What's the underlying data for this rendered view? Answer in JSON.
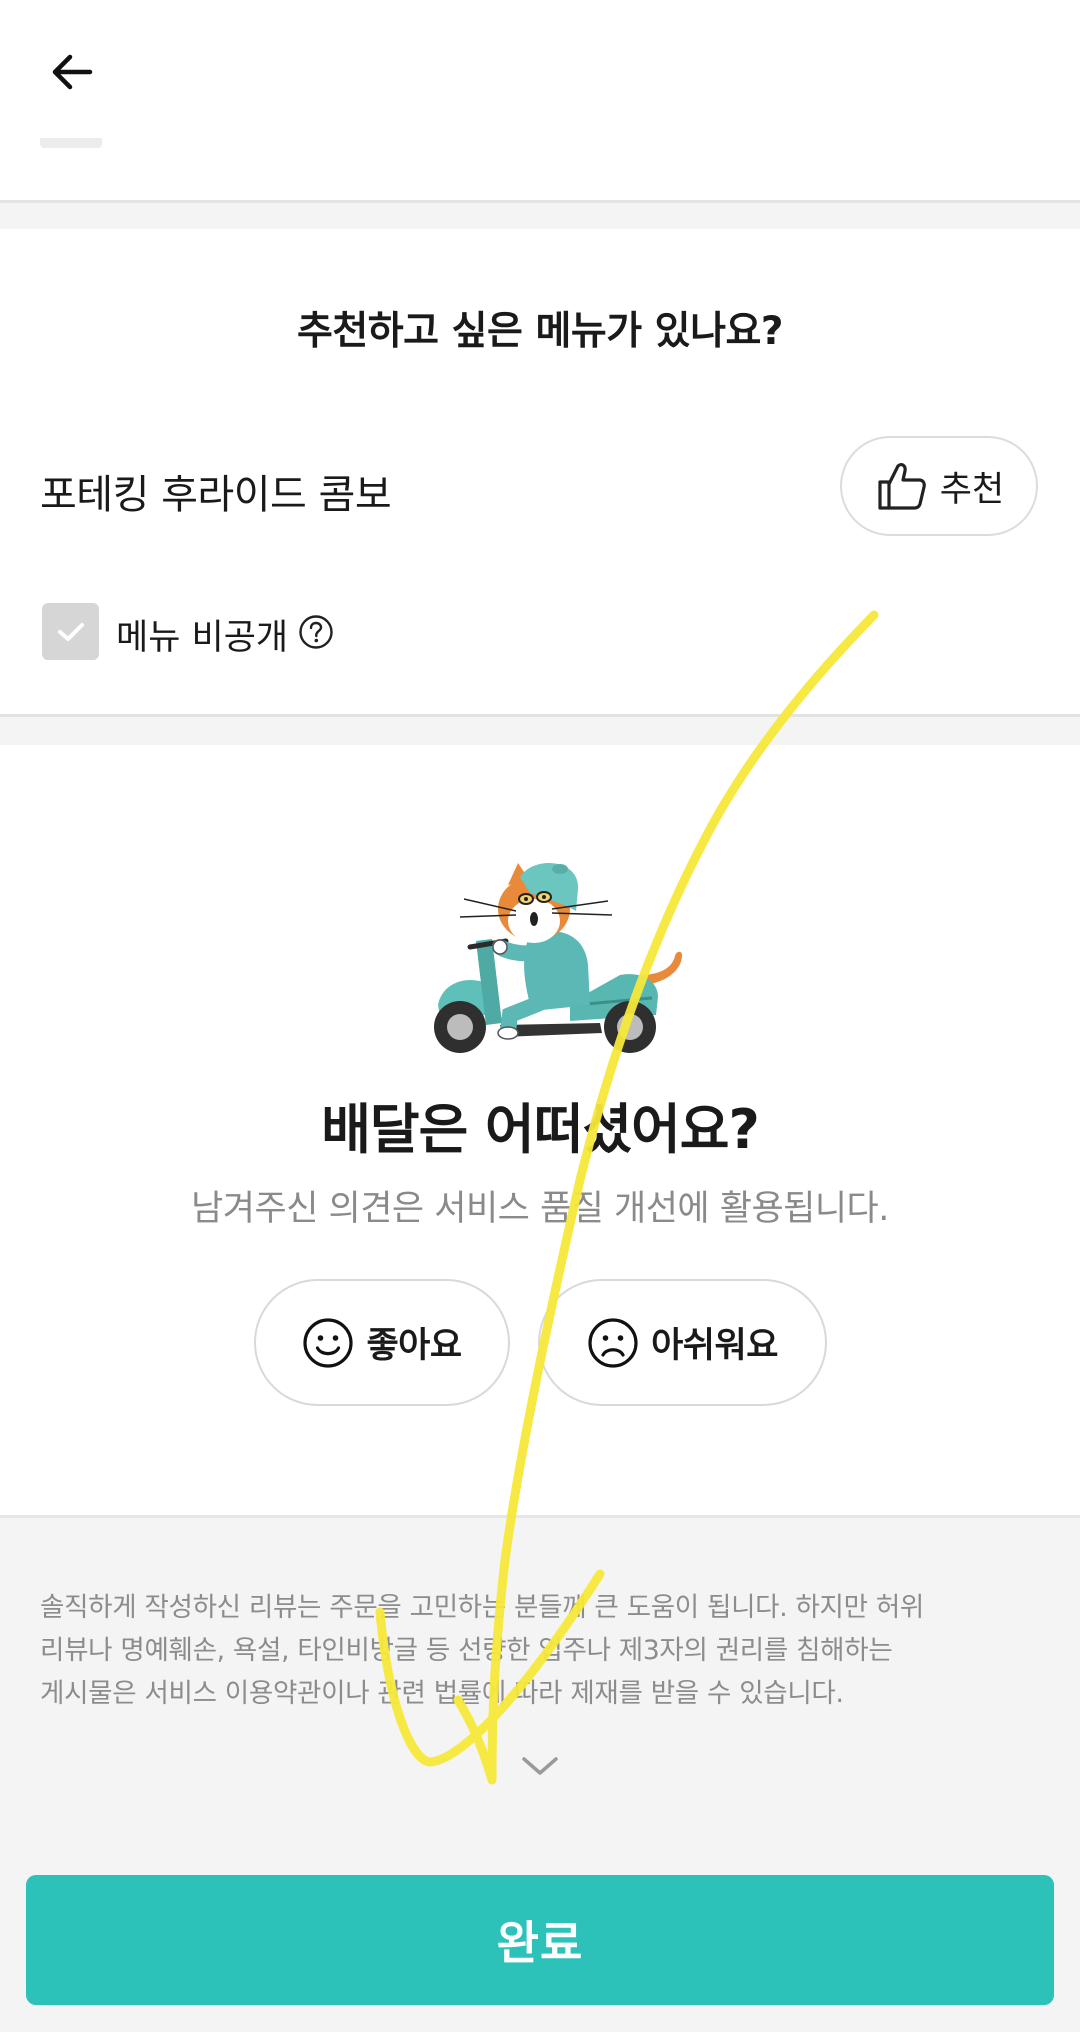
{
  "header": {
    "back_icon": "arrow-left-icon"
  },
  "recommend_section": {
    "title": "추천하고 싶은 메뉴가 있나요?",
    "menu_name": "포테킹 후라이드 콤보",
    "recommend_button": {
      "label": "추천",
      "icon": "thumbs-up-icon"
    },
    "private_checkbox": {
      "label": "메뉴 비공개",
      "checked": false,
      "help_icon": "question-circle-icon"
    }
  },
  "delivery_section": {
    "mascot": "cat-on-scooter-illustration",
    "title": "배달은 어떠셨어요?",
    "subtitle": "남겨주신 의견은 서비스 품질 개선에 활용됩니다.",
    "good_button": {
      "label": "좋아요",
      "icon": "smile-face-icon"
    },
    "bad_button": {
      "label": "아쉬워요",
      "icon": "sad-face-icon"
    }
  },
  "notice": {
    "lines": [
      "솔직하게 작성하신 리뷰는 주문을 고민하는 분들께 큰 도움이 됩니다. 하지만 허위",
      "리뷰나 명예훼손, 욕설, 타인비방글 등 선량한 업주나 제3자의 권리를 침해하는",
      "게시물은 서비스 이용약관이나 관련 법률에 따라 제재를 받을 수 있습니다."
    ],
    "expand_icon": "chevron-down-icon"
  },
  "complete_button": {
    "label": "완료"
  },
  "colors": {
    "accent": "#2cc1b9",
    "annotation": "#f7e83a"
  }
}
